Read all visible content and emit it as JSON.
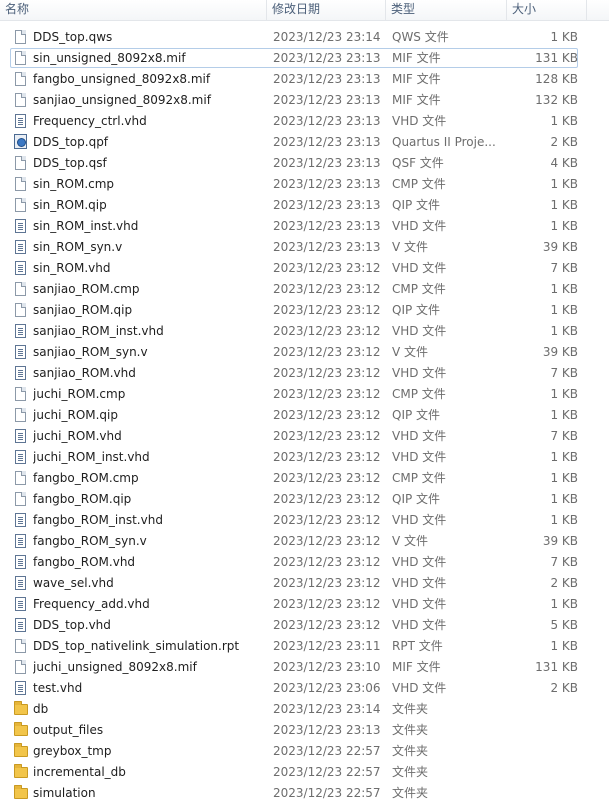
{
  "columns": {
    "name": "名称",
    "date": "修改日期",
    "type": "类型",
    "size": "大小"
  },
  "files": [
    {
      "name": "DDS_top.qws",
      "date": "2023/12/23 23:14",
      "type": "QWS 文件",
      "size": "1 KB",
      "icon": "file-icon"
    },
    {
      "name": "sin_unsigned_8092x8.mif",
      "date": "2023/12/23 23:13",
      "type": "MIF 文件",
      "size": "131 KB",
      "icon": "file-icon"
    },
    {
      "name": "fangbo_unsigned_8092x8.mif",
      "date": "2023/12/23 23:13",
      "type": "MIF 文件",
      "size": "128 KB",
      "icon": "file-icon"
    },
    {
      "name": "sanjiao_unsigned_8092x8.mif",
      "date": "2023/12/23 23:13",
      "type": "MIF 文件",
      "size": "132 KB",
      "icon": "file-icon"
    },
    {
      "name": "Frequency_ctrl.vhd",
      "date": "2023/12/23 23:13",
      "type": "VHD 文件",
      "size": "1 KB",
      "icon": "text-file-icon"
    },
    {
      "name": "DDS_top.qpf",
      "date": "2023/12/23 23:13",
      "type": "Quartus II Proje...",
      "size": "2 KB",
      "icon": "quartus-project-icon"
    },
    {
      "name": "DDS_top.qsf",
      "date": "2023/12/23 23:13",
      "type": "QSF 文件",
      "size": "4 KB",
      "icon": "file-icon"
    },
    {
      "name": "sin_ROM.cmp",
      "date": "2023/12/23 23:13",
      "type": "CMP 文件",
      "size": "1 KB",
      "icon": "file-icon"
    },
    {
      "name": "sin_ROM.qip",
      "date": "2023/12/23 23:13",
      "type": "QIP 文件",
      "size": "1 KB",
      "icon": "file-icon"
    },
    {
      "name": "sin_ROM_inst.vhd",
      "date": "2023/12/23 23:13",
      "type": "VHD 文件",
      "size": "1 KB",
      "icon": "text-file-icon"
    },
    {
      "name": "sin_ROM_syn.v",
      "date": "2023/12/23 23:13",
      "type": "V 文件",
      "size": "39 KB",
      "icon": "text-file-icon"
    },
    {
      "name": "sin_ROM.vhd",
      "date": "2023/12/23 23:12",
      "type": "VHD 文件",
      "size": "7 KB",
      "icon": "text-file-icon"
    },
    {
      "name": "sanjiao_ROM.cmp",
      "date": "2023/12/23 23:12",
      "type": "CMP 文件",
      "size": "1 KB",
      "icon": "file-icon"
    },
    {
      "name": "sanjiao_ROM.qip",
      "date": "2023/12/23 23:12",
      "type": "QIP 文件",
      "size": "1 KB",
      "icon": "file-icon"
    },
    {
      "name": "sanjiao_ROM_inst.vhd",
      "date": "2023/12/23 23:12",
      "type": "VHD 文件",
      "size": "1 KB",
      "icon": "text-file-icon"
    },
    {
      "name": "sanjiao_ROM_syn.v",
      "date": "2023/12/23 23:12",
      "type": "V 文件",
      "size": "39 KB",
      "icon": "text-file-icon"
    },
    {
      "name": "sanjiao_ROM.vhd",
      "date": "2023/12/23 23:12",
      "type": "VHD 文件",
      "size": "7 KB",
      "icon": "text-file-icon"
    },
    {
      "name": "juchi_ROM.cmp",
      "date": "2023/12/23 23:12",
      "type": "CMP 文件",
      "size": "1 KB",
      "icon": "file-icon"
    },
    {
      "name": "juchi_ROM.qip",
      "date": "2023/12/23 23:12",
      "type": "QIP 文件",
      "size": "1 KB",
      "icon": "file-icon"
    },
    {
      "name": "juchi_ROM.vhd",
      "date": "2023/12/23 23:12",
      "type": "VHD 文件",
      "size": "7 KB",
      "icon": "text-file-icon"
    },
    {
      "name": "juchi_ROM_inst.vhd",
      "date": "2023/12/23 23:12",
      "type": "VHD 文件",
      "size": "1 KB",
      "icon": "text-file-icon"
    },
    {
      "name": "fangbo_ROM.cmp",
      "date": "2023/12/23 23:12",
      "type": "CMP 文件",
      "size": "1 KB",
      "icon": "file-icon"
    },
    {
      "name": "fangbo_ROM.qip",
      "date": "2023/12/23 23:12",
      "type": "QIP 文件",
      "size": "1 KB",
      "icon": "file-icon"
    },
    {
      "name": "fangbo_ROM_inst.vhd",
      "date": "2023/12/23 23:12",
      "type": "VHD 文件",
      "size": "1 KB",
      "icon": "text-file-icon"
    },
    {
      "name": "fangbo_ROM_syn.v",
      "date": "2023/12/23 23:12",
      "type": "V 文件",
      "size": "39 KB",
      "icon": "text-file-icon"
    },
    {
      "name": "fangbo_ROM.vhd",
      "date": "2023/12/23 23:12",
      "type": "VHD 文件",
      "size": "7 KB",
      "icon": "text-file-icon"
    },
    {
      "name": "wave_sel.vhd",
      "date": "2023/12/23 23:12",
      "type": "VHD 文件",
      "size": "2 KB",
      "icon": "text-file-icon"
    },
    {
      "name": "Frequency_add.vhd",
      "date": "2023/12/23 23:12",
      "type": "VHD 文件",
      "size": "1 KB",
      "icon": "text-file-icon"
    },
    {
      "name": "DDS_top.vhd",
      "date": "2023/12/23 23:12",
      "type": "VHD 文件",
      "size": "5 KB",
      "icon": "text-file-icon"
    },
    {
      "name": "DDS_top_nativelink_simulation.rpt",
      "date": "2023/12/23 23:11",
      "type": "RPT 文件",
      "size": "1 KB",
      "icon": "file-icon"
    },
    {
      "name": "juchi_unsigned_8092x8.mif",
      "date": "2023/12/23 23:10",
      "type": "MIF 文件",
      "size": "131 KB",
      "icon": "file-icon"
    },
    {
      "name": "test.vhd",
      "date": "2023/12/23 23:06",
      "type": "VHD 文件",
      "size": "2 KB",
      "icon": "text-file-icon"
    },
    {
      "name": "db",
      "date": "2023/12/23 23:14",
      "type": "文件夹",
      "size": "",
      "icon": "folder-icon"
    },
    {
      "name": "output_files",
      "date": "2023/12/23 23:13",
      "type": "文件夹",
      "size": "",
      "icon": "folder-icon"
    },
    {
      "name": "greybox_tmp",
      "date": "2023/12/23 22:57",
      "type": "文件夹",
      "size": "",
      "icon": "folder-icon"
    },
    {
      "name": "incremental_db",
      "date": "2023/12/23 22:57",
      "type": "文件夹",
      "size": "",
      "icon": "folder-icon"
    },
    {
      "name": "simulation",
      "date": "2023/12/23 22:57",
      "type": "文件夹",
      "size": "",
      "icon": "folder-icon"
    }
  ],
  "selected_index": 1
}
